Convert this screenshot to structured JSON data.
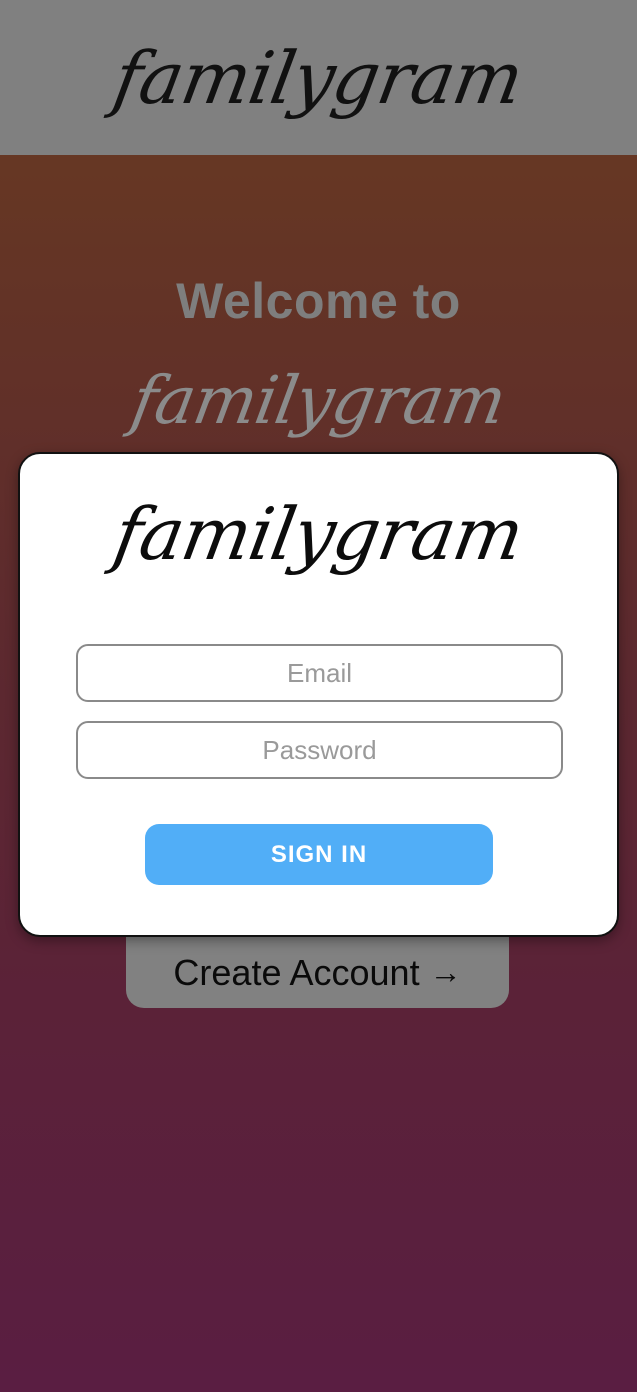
{
  "header": {
    "logo_text": "familygram"
  },
  "welcome": {
    "title": "Welcome to",
    "logo_text": "familygram",
    "create_account_label": "Create Account",
    "create_account_arrow": "→"
  },
  "signin_modal": {
    "logo_text": "familygram",
    "email_placeholder": "Email",
    "password_placeholder": "Password",
    "signin_label": "SIGN IN"
  },
  "colors": {
    "header_bg": "#808080",
    "gradient_top": "#6a3c21",
    "gradient_bottom": "#5a1e42",
    "signin_button": "#51aef7",
    "create_account_bg": "#818181"
  }
}
